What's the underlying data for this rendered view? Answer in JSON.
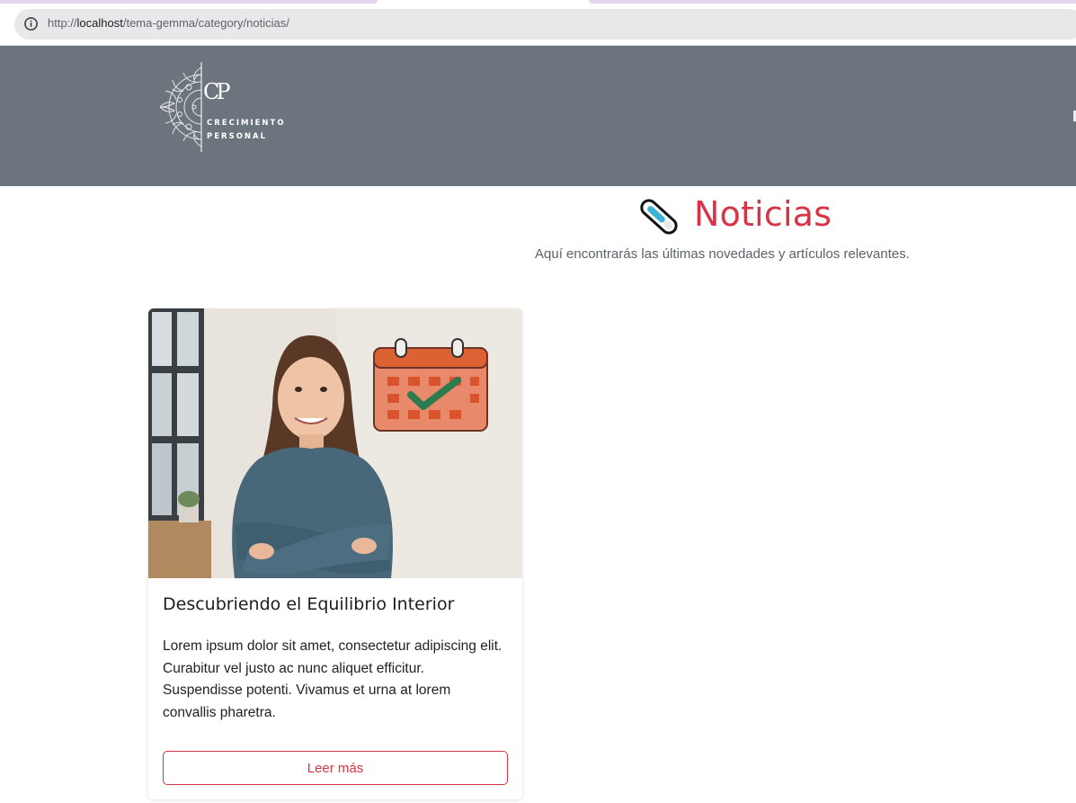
{
  "browser": {
    "url_prefix": "http://",
    "url_host": "localhost",
    "url_path": "/tema-gemma/category/noticias/"
  },
  "header": {
    "logo_monogram": "CP",
    "logo_line1": "CRECIMIENTO",
    "logo_line2": "PERSONAL"
  },
  "page": {
    "title_icon": "thermometer-icon",
    "title": "Noticias",
    "subtitle": "Aquí encontrarás las últimas novedades y artículos relevantes."
  },
  "posts": [
    {
      "title": "Descubriendo el Equilibrio Interior",
      "excerpt": "Lorem ipsum dolor sit amet, consectetur adipiscing elit. Curabitur vel justo ac nunc aliquet efficitur. Suspendisse potenti. Vivamus et urna at lorem convallis pharetra.",
      "button_label": "Leer más"
    }
  ],
  "colors": {
    "header_bg": "#6c757d",
    "accent": "#d63447"
  }
}
